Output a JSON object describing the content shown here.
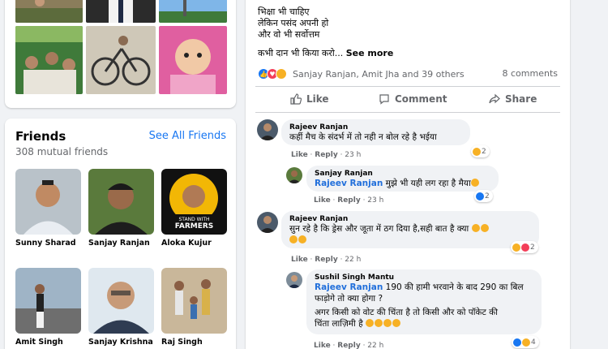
{
  "colors": {
    "link": "#1877f2",
    "mention": "#216fdb",
    "like": "#1877f2",
    "love": "#f33e58",
    "haha": "#f7b125"
  },
  "friends": {
    "title": "Friends",
    "mutual": "308 mutual friends",
    "see_all": "See All Friends",
    "list": [
      {
        "name": "Sunny Sharad"
      },
      {
        "name": "Sanjay Ranjan"
      },
      {
        "name": "Aloka Kujur"
      },
      {
        "name": "Amit Singh"
      },
      {
        "name": "Sanjay Krishna"
      },
      {
        "name": "Raj Singh"
      }
    ],
    "badge_line1": "STAND WITH",
    "badge_line2": "FARMERS"
  },
  "post": {
    "lines": [
      "भिक्षा भी चाहिए",
      "लेकिन पसंद अपनी हो",
      "और वो भी सर्वोत्तम"
    ],
    "last_line": "कभी दान भी किया करो...",
    "see_more": "See more",
    "reactors": "Sanjay Ranjan, Amit Jha and 39 others",
    "comments_count": "8 comments",
    "actions": {
      "like": "Like",
      "comment": "Comment",
      "share": "Share"
    }
  },
  "comments": [
    {
      "author": "Rajeev Ranjan",
      "text": "कहीं मैच के संदर्भ में तो नही न बोल रहे है भईया",
      "like": "Like",
      "reply": "Reply",
      "time": "23 h",
      "count": "2"
    },
    {
      "author": "Sanjay Ranjan",
      "mention": "Rajeev Ranjan",
      "text": "मुझे भी यही लग रहा है मैया",
      "like": "Like",
      "reply": "Reply",
      "time": "23 h",
      "count": "2"
    },
    {
      "author": "Rajeev Ranjan",
      "text": "सुन रहे है कि ड्रेस और जूता में ठग दिया है,सही बात है क्या",
      "like": "Like",
      "reply": "Reply",
      "time": "22 h",
      "count": "2"
    },
    {
      "author": "Sushil Singh Mantu",
      "mention": "Rajeev Ranjan",
      "text1": "190 की हामी भरवाने के बाद 290 का बिल",
      "text2": "फाड़ोगे तो क्या होगा ?",
      "text3": "अगर किसी को वोट की चिंता है तो किसी और को पॉकेट की",
      "text4": "चिंता लाज़िमी है",
      "like": "Like",
      "reply": "Reply",
      "time": "22 h",
      "count": "4"
    }
  ]
}
